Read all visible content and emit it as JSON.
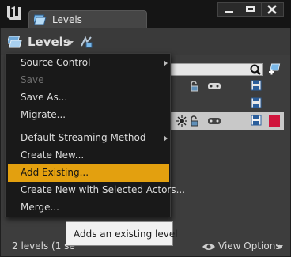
{
  "window": {
    "tab_title": "Levels",
    "controls": [
      "minimize-icon",
      "maximize-icon",
      "close-icon"
    ],
    "logo_icon": "unreal-engine-logo"
  },
  "toolbar": {
    "levels_label": "Levels",
    "levels_icon": "levels-stack-icon",
    "streaming_icon": "streaming-wizard-icon"
  },
  "level_list": {
    "search_icon": "search-icon",
    "add_icon": "add-level-icon",
    "rows": [
      {
        "icons": [
          "lock-icon",
          "gamepad-icon",
          "save-icon"
        ],
        "selected": false
      },
      {
        "icons": [
          "save-icon"
        ],
        "selected": false
      },
      {
        "icons": [
          "sun-icon",
          "lock-icon",
          "gamepad-icon",
          "save-icon",
          "color-swatch"
        ],
        "selected": true,
        "swatch": "#d0143c"
      }
    ]
  },
  "menu": {
    "items": [
      {
        "label": "Source Control",
        "submenu": true,
        "disabled": false
      },
      {
        "label": "Save",
        "submenu": false,
        "disabled": true
      },
      {
        "label": "Save As...",
        "submenu": false,
        "disabled": false
      },
      {
        "label": "Migrate...",
        "submenu": false,
        "disabled": false
      },
      {
        "label": "Default Streaming Method",
        "submenu": true,
        "disabled": false
      },
      {
        "label": "Create New...",
        "submenu": false,
        "disabled": false
      },
      {
        "label": "Add Existing...",
        "submenu": false,
        "disabled": false,
        "highlighted": true
      },
      {
        "label": "Create New with Selected Actors...",
        "submenu": false,
        "disabled": false
      },
      {
        "label": "Merge...",
        "submenu": false,
        "disabled": false
      }
    ]
  },
  "footer": {
    "status_text": "2 levels (1 se",
    "view_options_label": "View Options"
  },
  "tooltip": {
    "text": "Adds an existing level"
  },
  "colors": {
    "highlight": "#e3a00f",
    "selected_row": "#c8c8c8",
    "level_color": "#d0143c",
    "panel_bg": "#3d3d3d"
  }
}
